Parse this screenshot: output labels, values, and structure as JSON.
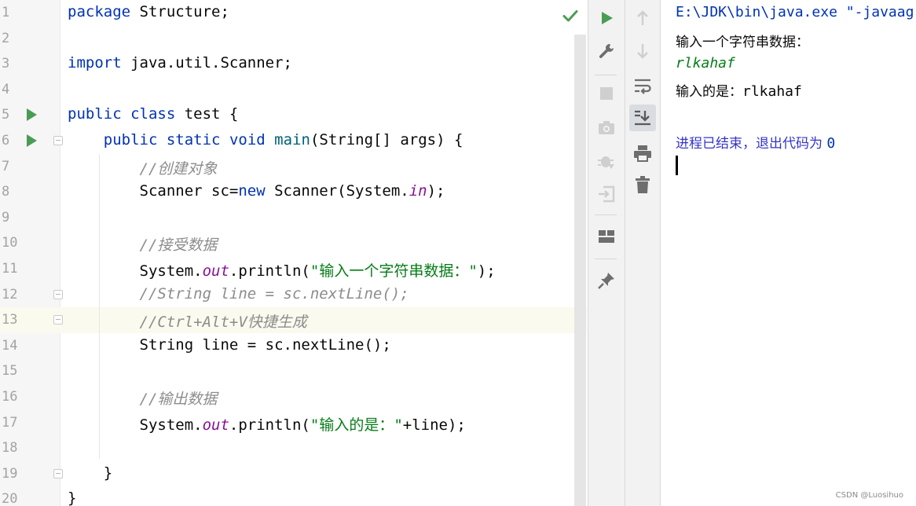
{
  "editor": {
    "lines": [
      {
        "n": "1",
        "text": "package Structure;"
      },
      {
        "n": "2",
        "text": ""
      },
      {
        "n": "3",
        "text": "import java.util.Scanner;"
      },
      {
        "n": "4",
        "text": ""
      },
      {
        "n": "5",
        "text": "public class test {"
      },
      {
        "n": "6",
        "text": "    public static void main(String[] args) {"
      },
      {
        "n": "7",
        "text": "        //创建对象"
      },
      {
        "n": "8",
        "text": "        Scanner sc=new Scanner(System.in);"
      },
      {
        "n": "9",
        "text": ""
      },
      {
        "n": "10",
        "text": "        //接受数据"
      },
      {
        "n": "11",
        "text": "        System.out.println(\"输入一个字符串数据：\");"
      },
      {
        "n": "12",
        "text": "        //String line = sc.nextLine();"
      },
      {
        "n": "13",
        "text": "        //Ctrl+Alt+V快捷生成"
      },
      {
        "n": "14",
        "text": "        String line = sc.nextLine();"
      },
      {
        "n": "15",
        "text": ""
      },
      {
        "n": "16",
        "text": "        //输出数据"
      },
      {
        "n": "17",
        "text": "        System.out.println(\"输入的是：\"+line);"
      },
      {
        "n": "18",
        "text": ""
      },
      {
        "n": "19",
        "text": "    }"
      },
      {
        "n": "20",
        "text": "}"
      }
    ],
    "current_line": "13"
  },
  "console": {
    "command": "E:\\JDK\\bin\\java.exe \"-javaag",
    "prompt": "输入一个字符串数据：",
    "user_input": "rlkahaf",
    "echo_label": "输入的是：",
    "echo_value": "rlkahaf",
    "exit_text": "进程已结束，退出代码为 ",
    "exit_code": "0"
  },
  "watermark": "CSDN @Luosihuo",
  "icons": {
    "gutter_run": "run-gutter-icon",
    "analysis_ok": "check-icon",
    "toolbar_left": [
      "run-icon",
      "wrench-icon",
      "stop-icon",
      "camera-icon",
      "debug-bug-icon",
      "login-icon",
      "layout-icon",
      "pin-icon"
    ],
    "toolbar_right": [
      "arrow-up-icon",
      "arrow-down-icon",
      "soft-wrap-icon",
      "scroll-to-end-icon",
      "print-icon",
      "trash-icon"
    ]
  },
  "colors": {
    "keyword": "#0033b3",
    "comment": "#8c8c8c",
    "string": "#067d17",
    "static_field": "#871094",
    "run_green": "#499c54"
  }
}
